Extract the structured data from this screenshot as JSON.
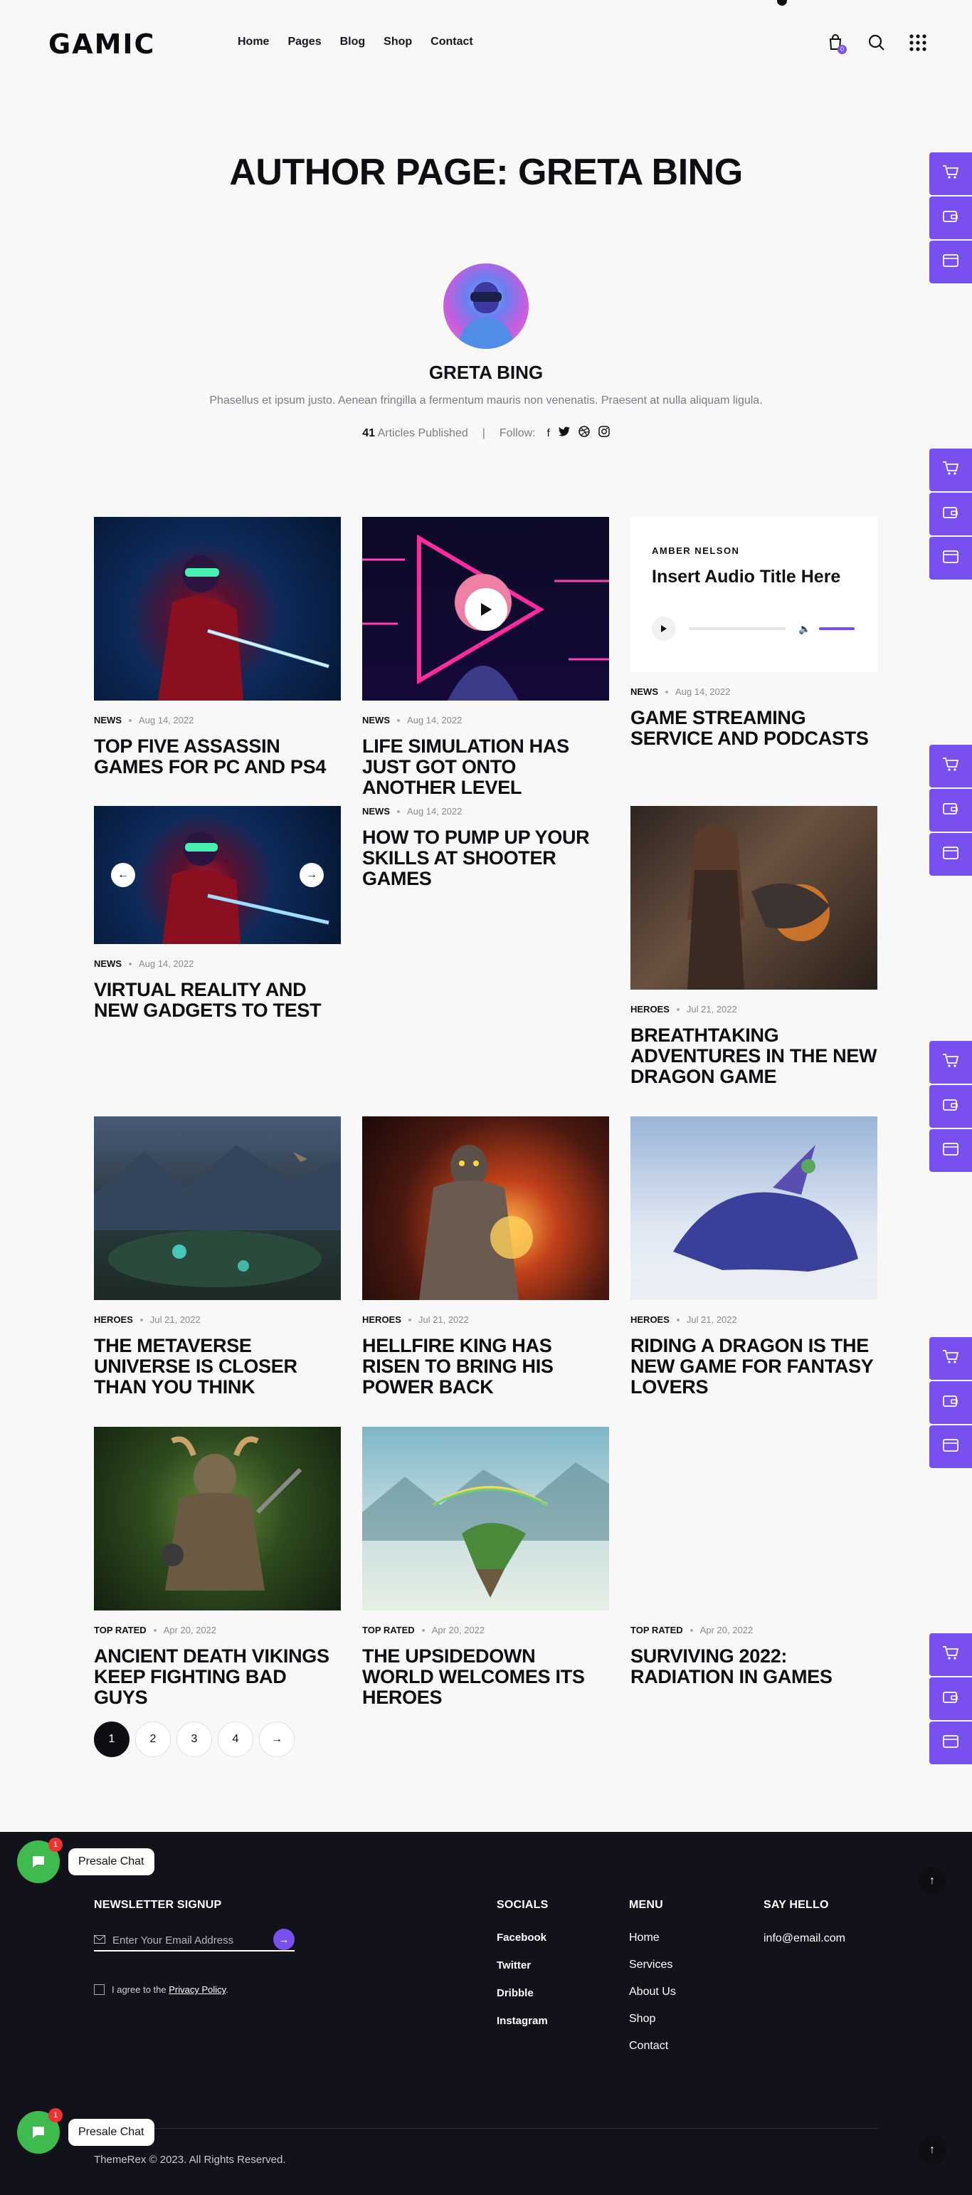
{
  "header": {
    "logo": "GAMIC",
    "nav": [
      "Home",
      "Pages",
      "Blog",
      "Shop",
      "Contact"
    ],
    "cart_count": "0"
  },
  "page_title": "AUTHOR PAGE: GRETA BING",
  "author": {
    "name": "GRETA BING",
    "bio": "Phasellus et ipsum justo. Aenean fringilla a fermentum mauris non venenatis. Praesent at nulla aliquam ligula.",
    "articles_count": "41",
    "articles_label": "Articles Published",
    "follow_label": "Follow:"
  },
  "audio": {
    "artist": "AMBER NELSON",
    "title": "Insert Audio Title Here"
  },
  "posts": [
    {
      "category": "News",
      "date": "Aug 14, 2022",
      "title": "Top Five Assassin Games for PC and PS4"
    },
    {
      "category": "News",
      "date": "Aug 14, 2022",
      "title": "Life Simulation Has Just Got Onto Another Level"
    },
    {
      "category": "News",
      "date": "Aug 14, 2022",
      "title": "Game Streaming Service and Podcasts"
    },
    {
      "category": "News",
      "date": "Aug 14, 2022",
      "title": "Virtual Reality and New Gadgets to Test"
    },
    {
      "category": "News",
      "date": "Aug 14, 2022",
      "title": "How to Pump Up Your Skills at Shooter Games"
    },
    {
      "category": "Heroes",
      "date": "Jul 21, 2022",
      "title": "Breathtaking Adventures in the New Dragon Game"
    },
    {
      "category": "Heroes",
      "date": "Jul 21, 2022",
      "title": "The Metaverse Universe Is Closer Than You Think"
    },
    {
      "category": "Heroes",
      "date": "Jul 21, 2022",
      "title": "Hellfire King Has Risen to Bring His Power Back"
    },
    {
      "category": "Heroes",
      "date": "Jul 21, 2022",
      "title": "Riding a Dragon Is the New Game for Fantasy Lovers"
    },
    {
      "category": "Top Rated",
      "date": "Apr 20, 2022",
      "title": "Ancient Death Vikings Keep Fighting Bad Guys"
    },
    {
      "category": "Top Rated",
      "date": "Apr 20, 2022",
      "title": "The Upsidedown World Welcomes Its Heroes"
    },
    {
      "category": "Top Rated",
      "date": "Apr 20, 2022",
      "title": "Surviving 2022: Radiation in Games"
    }
  ],
  "pagination": {
    "pages": [
      "1",
      "2",
      "3",
      "4"
    ],
    "next": "→"
  },
  "footer": {
    "newsletter_heading": "Newsletter Signup",
    "email_placeholder": "Enter Your Email Address",
    "agree_text": "I agree to the",
    "privacy_link": "Privacy Policy",
    "socials_heading": "Socials",
    "socials": [
      "Facebook",
      "Twitter",
      "Dribble",
      "Instagram"
    ],
    "menu_heading": "Menu",
    "menu": [
      "Home",
      "Services",
      "About Us",
      "Shop",
      "Contact"
    ],
    "hello_heading": "Say Hello",
    "email": "info@email.com",
    "copyright": "ThemeRex © 2023. All Rights Reserved."
  },
  "chat": {
    "label": "Presale Chat",
    "badge": "1"
  },
  "colors": {
    "accent": "#7a4ff0",
    "footer_bg": "#12121b",
    "chat": "#3fba4e"
  }
}
